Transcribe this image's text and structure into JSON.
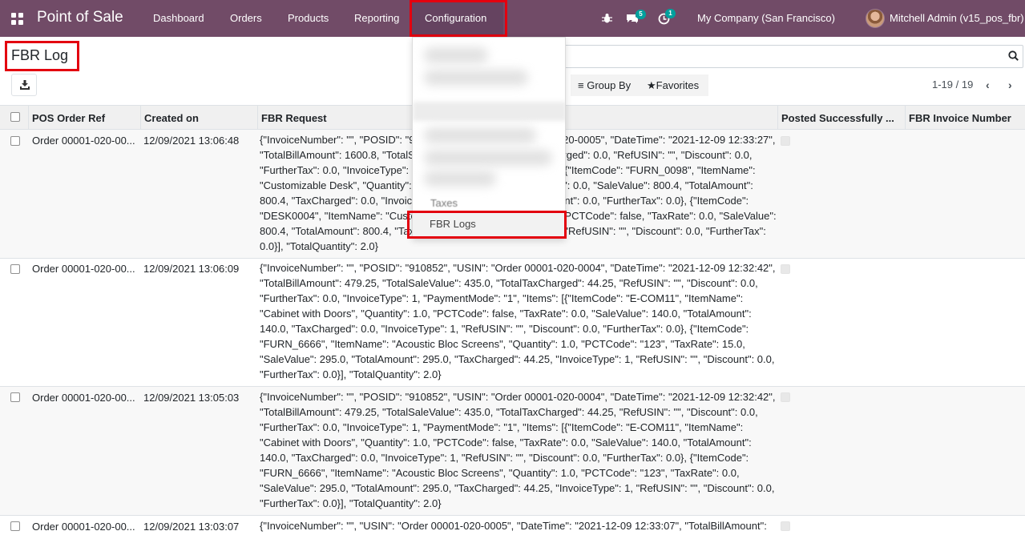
{
  "navbar": {
    "app_name": "Point of Sale",
    "menu": [
      "Dashboard",
      "Orders",
      "Products",
      "Reporting",
      "Configuration"
    ],
    "activity_badge": "5",
    "messages_badge": "1",
    "company": "My Company (San Francisco)",
    "user": "Mitchell Admin (v15_pos_fbr)",
    "color": "#714b67"
  },
  "control_panel": {
    "title": "FBR Log",
    "search_placeholder": "",
    "group_by_label": "Group By",
    "favorites_label": "Favorites",
    "pager": "1-19 / 19"
  },
  "dropdown": {
    "items_visible": [
      "Taxes",
      "FBR Logs"
    ],
    "selected": "FBR Logs"
  },
  "table": {
    "headers": [
      "POS Order Ref",
      "Created on",
      "FBR Request",
      "Posted Successfully ...",
      "FBR Invoice Number"
    ],
    "rows": [
      {
        "ref": "Order 00001-020-00...",
        "created": "12/09/2021 13:06:48",
        "request": "{\"InvoiceNumber\": \"\", \"POSID\": \"910852\", \"USIN\": \"Order 00001-020-0005\", \"DateTime\": \"2021-12-09 12:33:27\", \"TotalBillAmount\": 1600.8, \"TotalSaleValue\": 1600.8, \"TotalTaxCharged\": 0.0, \"RefUSIN\": \"\", \"Discount\": 0.0, \"FurtherTax\": 0.0, \"InvoiceType\": 1, \"PaymentMode\": \"1\", \"Items\": [{\"ItemCode\": \"FURN_0098\", \"ItemName\": \"Customizable Desk\", \"Quantity\": 1.0, \"PCTCode\": false, \"TaxRate\": 0.0, \"SaleValue\": 800.4, \"TotalAmount\": 800.4, \"TaxCharged\": 0.0, \"InvoiceType\": 1, \"RefUSIN\": \"\", \"Discount\": 0.0, \"FurtherTax\": 0.0}, {\"ItemCode\": \"DESK0004\", \"ItemName\": \"Customizable Desk\", \"Quantity\": 1.0, \"PCTCode\": false, \"TaxRate\": 0.0, \"SaleValue\": 800.4, \"TotalAmount\": 800.4, \"TaxCharged\": 0.0, \"InvoiceType\": 1, \"RefUSIN\": \"\", \"Discount\": 0.0, \"FurtherTax\": 0.0}], \"TotalQuantity\": 2.0}"
      },
      {
        "ref": "Order 00001-020-00...",
        "created": "12/09/2021 13:06:09",
        "request": "{\"InvoiceNumber\": \"\", \"POSID\": \"910852\", \"USIN\": \"Order 00001-020-0004\", \"DateTime\": \"2021-12-09 12:32:42\", \"TotalBillAmount\": 479.25, \"TotalSaleValue\": 435.0, \"TotalTaxCharged\": 44.25, \"RefUSIN\": \"\", \"Discount\": 0.0, \"FurtherTax\": 0.0, \"InvoiceType\": 1, \"PaymentMode\": \"1\", \"Items\": [{\"ItemCode\": \"E-COM11\", \"ItemName\": \"Cabinet with Doors\", \"Quantity\": 1.0, \"PCTCode\": false, \"TaxRate\": 0.0, \"SaleValue\": 140.0, \"TotalAmount\": 140.0, \"TaxCharged\": 0.0, \"InvoiceType\": 1, \"RefUSIN\": \"\", \"Discount\": 0.0, \"FurtherTax\": 0.0}, {\"ItemCode\": \"FURN_6666\", \"ItemName\": \"Acoustic Bloc Screens\", \"Quantity\": 1.0, \"PCTCode\": \"123\", \"TaxRate\": 15.0, \"SaleValue\": 295.0, \"TotalAmount\": 295.0, \"TaxCharged\": 44.25, \"InvoiceType\": 1, \"RefUSIN\": \"\", \"Discount\": 0.0, \"FurtherTax\": 0.0}], \"TotalQuantity\": 2.0}"
      },
      {
        "ref": "Order 00001-020-00...",
        "created": "12/09/2021 13:05:03",
        "request": "{\"InvoiceNumber\": \"\", \"POSID\": \"910852\", \"USIN\": \"Order 00001-020-0004\", \"DateTime\": \"2021-12-09 12:32:42\", \"TotalBillAmount\": 479.25, \"TotalSaleValue\": 435.0, \"TotalTaxCharged\": 44.25, \"RefUSIN\": \"\", \"Discount\": 0.0, \"FurtherTax\": 0.0, \"InvoiceType\": 1, \"PaymentMode\": \"1\", \"Items\": [{\"ItemCode\": \"E-COM11\", \"ItemName\": \"Cabinet with Doors\", \"Quantity\": 1.0, \"PCTCode\": false, \"TaxRate\": 0.0, \"SaleValue\": 140.0, \"TotalAmount\": 140.0, \"TaxCharged\": 0.0, \"InvoiceType\": 1, \"RefUSIN\": \"\", \"Discount\": 0.0, \"FurtherTax\": 0.0}, {\"ItemCode\": \"FURN_6666\", \"ItemName\": \"Acoustic Bloc Screens\", \"Quantity\": 1.0, \"PCTCode\": \"123\", \"TaxRate\": 0.0, \"SaleValue\": 295.0, \"TotalAmount\": 295.0, \"TaxCharged\": 44.25, \"InvoiceType\": 1, \"RefUSIN\": \"\", \"Discount\": 0.0, \"FurtherTax\": 0.0}], \"TotalQuantity\": 2.0}"
      },
      {
        "ref": "Order 00001-020-00...",
        "created": "12/09/2021 13:03:07",
        "request": "{\"InvoiceNumber\": \"\", \"USIN\": \"Order 00001-020-0005\", \"DateTime\": \"2021-12-09 12:33:07\", \"TotalBillAmount\":"
      }
    ]
  }
}
